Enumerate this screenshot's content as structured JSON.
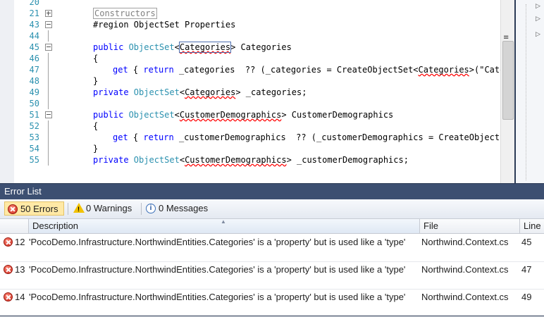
{
  "editor": {
    "lines": [
      {
        "n": "20",
        "parts": []
      },
      {
        "n": "21",
        "fold": "plus",
        "parts": [
          {
            "t": "Constructors",
            "c": "collapsed"
          }
        ]
      },
      {
        "n": "43",
        "fold": "minus",
        "parts": [
          {
            "t": "#region ObjectSet Properties"
          }
        ]
      },
      {
        "n": "44",
        "parts": []
      },
      {
        "n": "45",
        "fold": "minus",
        "parts": [
          {
            "t": "public ",
            "c": "kw"
          },
          {
            "t": "ObjectSet",
            "c": "ty"
          },
          {
            "t": "<"
          },
          {
            "t": "Categories",
            "c": "err caret-box"
          },
          {
            "t": "> Categories"
          }
        ]
      },
      {
        "n": "46",
        "parts": [
          {
            "t": "{"
          }
        ]
      },
      {
        "n": "47",
        "indent": 2,
        "parts": [
          {
            "t": "get",
            "c": "kw"
          },
          {
            "t": " { "
          },
          {
            "t": "return",
            "c": "kw"
          },
          {
            "t": " _categories  ?? (_categories = CreateObjectSet<"
          },
          {
            "t": "Categories",
            "c": "err"
          },
          {
            "t": ">(\"Categ"
          }
        ]
      },
      {
        "n": "48",
        "parts": [
          {
            "t": "}"
          }
        ]
      },
      {
        "n": "49",
        "parts": [
          {
            "t": "private ",
            "c": "kw"
          },
          {
            "t": "ObjectSet",
            "c": "ty"
          },
          {
            "t": "<"
          },
          {
            "t": "Categories",
            "c": "err"
          },
          {
            "t": "> _categories;"
          }
        ]
      },
      {
        "n": "50",
        "parts": []
      },
      {
        "n": "51",
        "fold": "minus",
        "parts": [
          {
            "t": "public ",
            "c": "kw"
          },
          {
            "t": "ObjectSet",
            "c": "ty"
          },
          {
            "t": "<"
          },
          {
            "t": "CustomerDemographics",
            "c": "err"
          },
          {
            "t": "> CustomerDemographics"
          }
        ]
      },
      {
        "n": "52",
        "parts": [
          {
            "t": "{"
          }
        ]
      },
      {
        "n": "53",
        "indent": 2,
        "parts": [
          {
            "t": "get",
            "c": "kw"
          },
          {
            "t": " { "
          },
          {
            "t": "return",
            "c": "kw"
          },
          {
            "t": " _customerDemographics  ?? (_customerDemographics = CreateObjectSet"
          }
        ]
      },
      {
        "n": "54",
        "parts": [
          {
            "t": "}"
          }
        ]
      },
      {
        "n": "55",
        "parts": [
          {
            "t": "private ",
            "c": "kw"
          },
          {
            "t": "ObjectSet",
            "c": "ty"
          },
          {
            "t": "<"
          },
          {
            "t": "CustomerDemographics",
            "c": "err"
          },
          {
            "t": "> _customerDemographics;"
          }
        ]
      }
    ],
    "scroll_grip": "≡"
  },
  "error_list": {
    "title": "Error List",
    "filters": {
      "errors": "50 Errors",
      "warnings": "0 Warnings",
      "messages": "0 Messages"
    },
    "columns": {
      "description": "Description",
      "file": "File",
      "line": "Line"
    },
    "rows": [
      {
        "num": "12",
        "description": "'PocoDemo.Infrastructure.NorthwindEntities.Categories' is a 'property' but is used like a 'type'",
        "file": "Northwind.Context.cs",
        "line": "45"
      },
      {
        "num": "13",
        "description": "'PocoDemo.Infrastructure.NorthwindEntities.Categories' is a 'property' but is used like a 'type'",
        "file": "Northwind.Context.cs",
        "line": "47"
      },
      {
        "num": "14",
        "description": "'PocoDemo.Infrastructure.NorthwindEntities.Categories' is a 'property' but is used like a 'type'",
        "file": "Northwind.Context.cs",
        "line": "49"
      }
    ]
  },
  "icons": {
    "fold_plus": "fold-plus-icon",
    "fold_minus": "fold-minus-icon",
    "error": "error-icon",
    "warning": "warning-icon",
    "info": "info-icon"
  },
  "colors": {
    "keyword": "#0000ff",
    "type": "#2b91af",
    "squiggle": "#ff0000",
    "titlebar": "#3c4f71",
    "active_filter": "#ffe9a6"
  }
}
